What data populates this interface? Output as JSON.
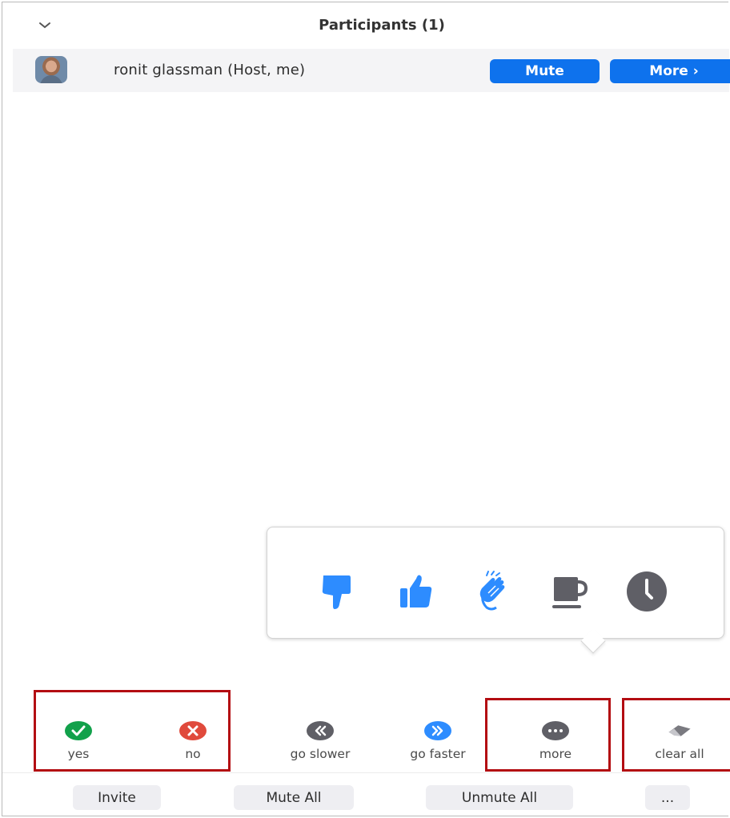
{
  "header": {
    "title": "Participants (1)",
    "collapse_icon": "chevron-down-icon"
  },
  "participants": [
    {
      "name": "ronit glassman (Host, me)",
      "mute_label": "Mute",
      "more_label": "More ›"
    }
  ],
  "reactions": [
    {
      "name": "thumbs-down-icon",
      "color": "#2d8cff"
    },
    {
      "name": "thumbs-up-icon",
      "color": "#2d8cff"
    },
    {
      "name": "clapping-hands-icon",
      "color": "#2d8cff"
    },
    {
      "name": "coffee-cup-icon",
      "color": "#5f5f66"
    },
    {
      "name": "clock-icon",
      "color": "#5f5f66"
    }
  ],
  "feedback": {
    "yes_label": "yes",
    "no_label": "no",
    "slower_label": "go slower",
    "faster_label": "go faster",
    "more_label": "more",
    "clear_label": "clear all"
  },
  "bottom_actions": {
    "invite": "Invite",
    "mute_all": "Mute All",
    "unmute_all": "Unmute All",
    "more": "..."
  },
  "colors": {
    "accent_blue": "#0e72ed",
    "yes_green": "#12a14b",
    "no_red": "#e04a3c",
    "highlight_red": "#b30d12",
    "neutral_gray": "#5f5f66"
  }
}
